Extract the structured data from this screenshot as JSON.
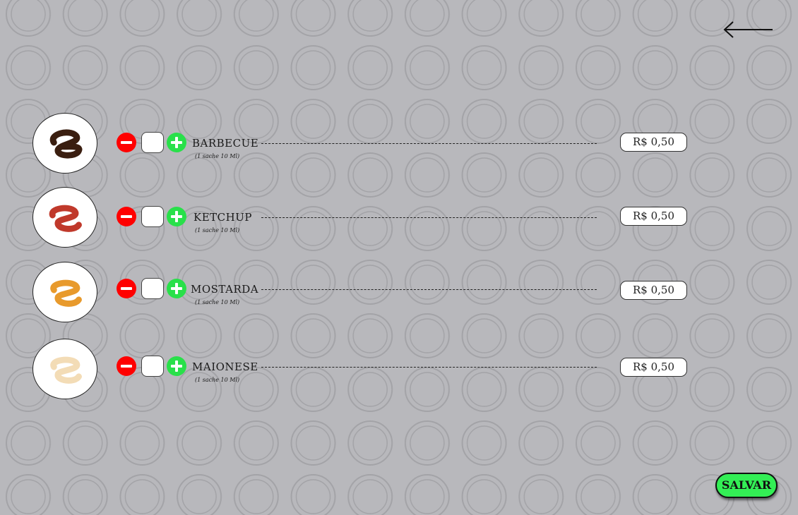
{
  "colors": {
    "background": "#b8b8bc",
    "minus": "#ff0000",
    "plus": "#29e04a",
    "save": "#33ee55"
  },
  "header": {
    "back_icon": "arrow-left-icon"
  },
  "items": [
    {
      "name": "BARBECUE",
      "subtitle": "(1 sache 10 Ml)",
      "quantity": "",
      "price": "R$  0,50",
      "sauce_color": "#3a1e10"
    },
    {
      "name": "KETCHUP",
      "subtitle": "(1 sache 10 Ml)",
      "quantity": "",
      "price": "R$  0,50",
      "sauce_color": "#c0392b"
    },
    {
      "name": "MOSTARDA",
      "subtitle": "(1 sache 10 Ml)",
      "quantity": "",
      "price": "R$  0,50",
      "sauce_color": "#e89a2c"
    },
    {
      "name": "MAIONESE",
      "subtitle": "(1 sache 10 Ml)",
      "quantity": "",
      "price": "R$  0,50",
      "sauce_color": "#f3dcb6"
    }
  ],
  "footer": {
    "save_label": "SALVAR"
  }
}
